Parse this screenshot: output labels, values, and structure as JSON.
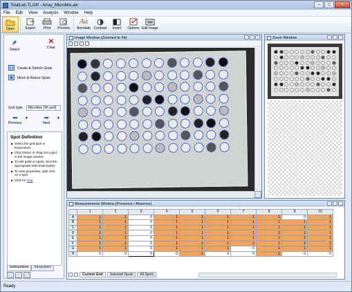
{
  "title": "TotalLab TL100 - Array_Microtitre.aiv",
  "menu": [
    "File",
    "Edit",
    "View",
    "Analysis",
    "Window",
    "Help"
  ],
  "toolbar": [
    {
      "label": "Open",
      "icon": "folder-icon"
    },
    {
      "label": "Export",
      "icon": "export-icon"
    },
    {
      "label": "Print",
      "icon": "printer-icon"
    },
    {
      "label": "Preview",
      "icon": "preview-icon"
    },
    {
      "label": "Annotate",
      "icon": "annotate-icon"
    },
    {
      "label": "Contrast",
      "icon": "contrast-icon"
    },
    {
      "label": "Invert",
      "icon": "invert-icon"
    },
    {
      "label": "Options",
      "icon": "options-icon"
    },
    {
      "label": "Edit Image",
      "icon": "edit-image-icon"
    }
  ],
  "left_panel": {
    "detect": "Detect",
    "clear": "Clear",
    "create_grids": "Create & Stretch Grids",
    "move_spots": "Move & Resize Spots",
    "grid_type_label": "Grid type:",
    "grid_type_value": "Microtitre (96 well)",
    "previous": "Previous",
    "next": "Next",
    "instructions": {
      "heading": "Spot Definition",
      "items": [
        "Select the grid type in Parameters",
        "Click Detect or drag out a grid in the Image window",
        "To edit grids or spots, click the appropriate edit mode button",
        "To view properties, right click on a spot"
      ],
      "click_for": "Click for",
      "help_link": "help"
    },
    "tabs": [
      "Instructions",
      "Parameters"
    ]
  },
  "image_window": {
    "title": "Image Window (Zoomed to Fit)"
  },
  "zoom_window": {
    "title": "Zoom Window"
  },
  "measurements": {
    "title": "Measurements Window [Presence / Absence]",
    "columns": [
      "1",
      "2",
      "3",
      "4",
      "5",
      "6",
      "7",
      "8",
      "9",
      "10"
    ],
    "rows": [
      {
        "label": "A",
        "values": [
          "1",
          "1",
          "0",
          "1",
          "1",
          "1",
          "1",
          "1",
          "0",
          "1"
        ]
      },
      {
        "label": "B",
        "values": [
          "1",
          "1",
          "0",
          "1",
          "1",
          "1",
          "1",
          "1",
          "1",
          "1"
        ]
      },
      {
        "label": "C",
        "values": [
          "1",
          "1",
          "0",
          "1",
          "1",
          "1",
          "1",
          "1",
          "1",
          "1"
        ]
      },
      {
        "label": "D",
        "values": [
          "1",
          "1",
          "0",
          "1",
          "1",
          "1",
          "1",
          "1",
          "1",
          "1"
        ]
      },
      {
        "label": "E",
        "values": [
          "1",
          "1",
          "0",
          "1",
          "1",
          "1",
          "1",
          "1",
          "1",
          "1"
        ]
      },
      {
        "label": "F",
        "values": [
          "1",
          "1",
          "0",
          "1",
          "1",
          "1",
          "1",
          "1",
          "1",
          "1"
        ]
      },
      {
        "label": "G",
        "values": [
          "1",
          "1",
          "0",
          "1",
          "1",
          "1",
          "0",
          "1",
          "1",
          "1"
        ]
      },
      {
        "label": "H",
        "values": [
          "0",
          "0",
          "0",
          "0",
          "1",
          "0",
          "0",
          "1",
          "0",
          "0"
        ]
      }
    ],
    "tabs": [
      "Current Grid",
      "Selected Spots",
      "All Spots"
    ]
  },
  "status": "Ready",
  "colors": {
    "present": "#f5a25d",
    "well_outline": "#4f67c6",
    "title_bar": "#b9cbe4"
  }
}
